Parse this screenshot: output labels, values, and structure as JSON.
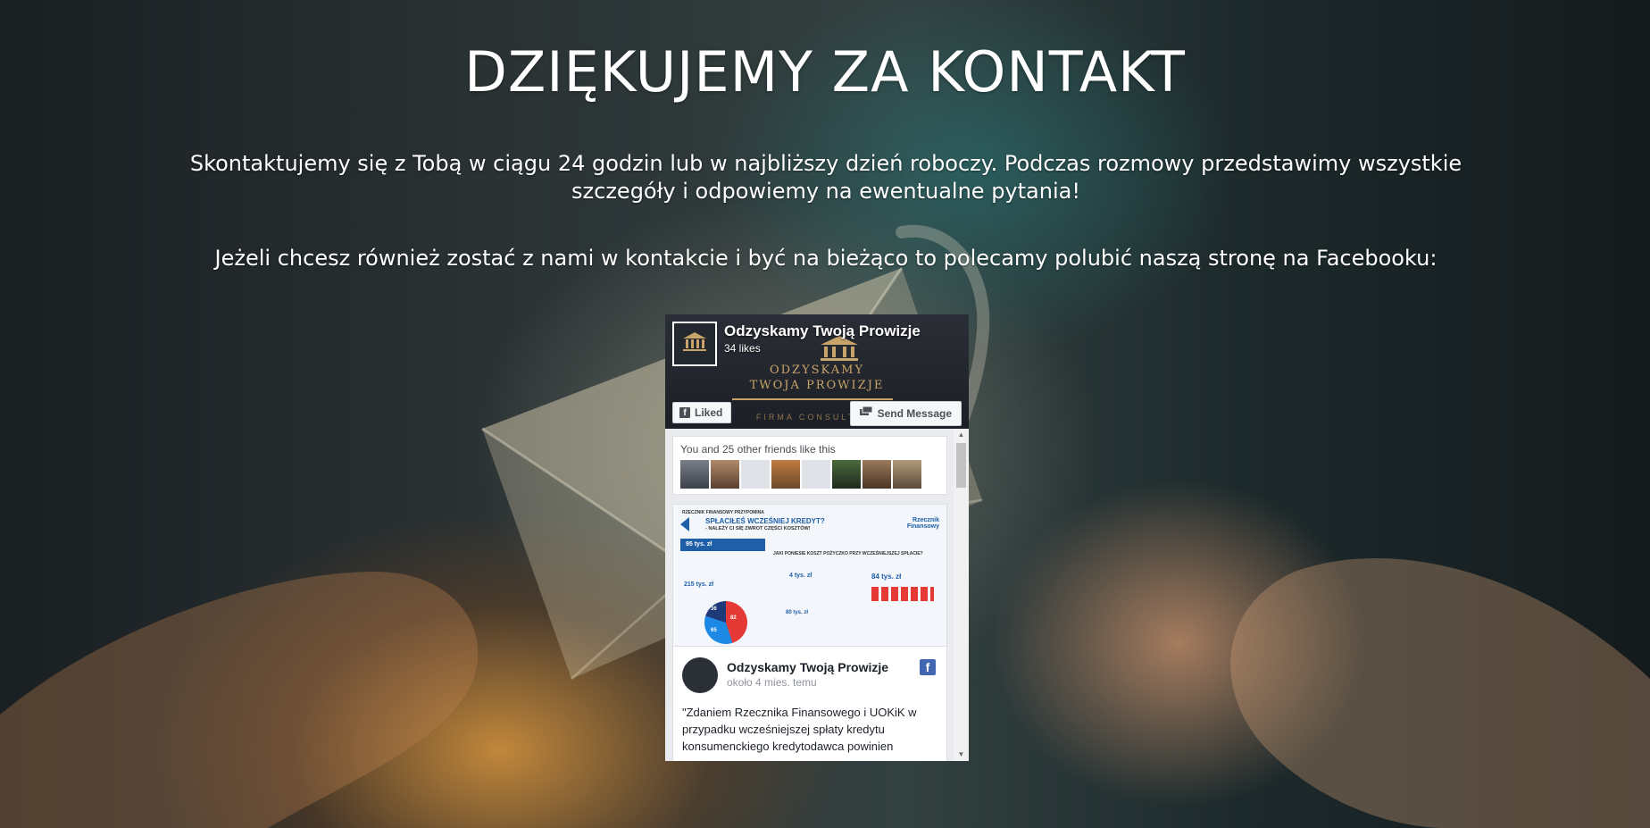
{
  "heading": "DZIĘKUJEMY ZA KONTAKT",
  "paragraph1": "Skontaktujemy się z Tobą w ciągu 24 godzin lub w najbliższy dzień roboczy. Podczas rozmowy przedstawimy wszystkie szczegóły i odpowiemy na ewentualne pytania!",
  "paragraph2": "Jeżeli chcesz również zostać z nami w kontakcie i być na bieżąco to polecamy polubić naszą stronę na Facebooku:",
  "fb_widget": {
    "page_name": "Odzyskamy Twoją Prowizje",
    "likes": "34 likes",
    "cover_brand_line1": "ODZYSKAMY",
    "cover_brand_line2": "TWOJA PROWIZJE",
    "cover_sub": "FIRMA CONSULTING",
    "liked_label": "Liked",
    "send_message_label": "Send Message",
    "friends_text": "You and 25 other friends like this",
    "friends_count": 8,
    "post": {
      "author": "Odzyskamy Twoją Prowizje",
      "time": "około 4 mies. temu",
      "text": "\"Zdaniem Rzecznika Finansowego i UOKiK w przypadku wcześniejszej spłaty kredytu konsumenckiego kredytodawca powinien"
    },
    "infographic": {
      "header": "RZECZNIK FINANSOWY PRZYPOMINA",
      "headline": "SPŁACIŁEŚ WCZEŚNIEJ KREDYT?",
      "subline": "- NALEŻY CI SIĘ ZWROT CZĘŚCI KOSZTÓW!",
      "brand": "Rzecznik Finansowy",
      "stat1": "95 tys. zł",
      "stat2": "215 tys. zł",
      "question": "JAKI PONIESIE KOSZT POŻYCZKO PRZY WCZEŚNIEJSZEJ SPŁACIE?",
      "value1": "4 tys. zł",
      "value2": "84 tys. zł",
      "value3": "80 tys. zł",
      "pie_a": "36",
      "pie_b": "65",
      "pie_c": "82"
    }
  },
  "colors": {
    "fb_blue": "#4267b2",
    "gold": "#c9a46a"
  }
}
